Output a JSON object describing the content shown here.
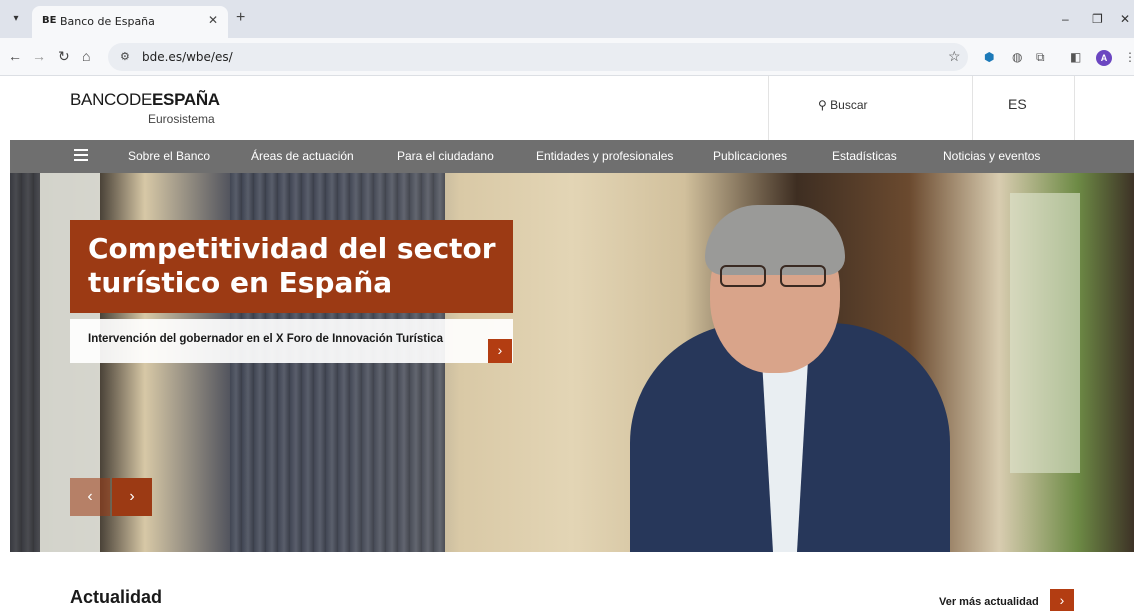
{
  "browser": {
    "tab_title": "Banco de España",
    "tab_favicon": "BE",
    "url": "bde.es/wbe/es/",
    "avatar_letter": "A"
  },
  "header": {
    "logo_banco": "BANCO",
    "logo_de": "DE",
    "logo_espana": "ESPAÑA",
    "logo_sub": "Eurosistema",
    "search_label": "Buscar",
    "lang": "ES"
  },
  "nav": {
    "items": [
      "Sobre el Banco",
      "Áreas de actuación",
      "Para el ciudadano",
      "Entidades y profesionales",
      "Publicaciones",
      "Estadísticas",
      "Noticias y eventos"
    ]
  },
  "hero": {
    "title": "Competitividad del sector turístico en España",
    "subtitle": "Intervención del gobernador en el X Foro de Innovación Turística"
  },
  "news": {
    "title": "Actualidad",
    "more_label": "Ver más actualidad"
  },
  "colors": {
    "accent": "#9c3a14",
    "nav_bg": "#6f6f6f"
  }
}
